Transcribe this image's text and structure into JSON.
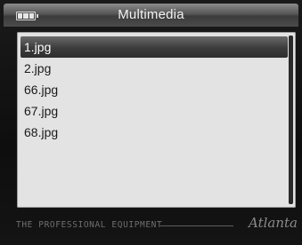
{
  "window": {
    "title": "Multimedia"
  },
  "status": {
    "battery_icon": "battery-icon"
  },
  "files": [
    {
      "name": "1.jpg",
      "selected": true
    },
    {
      "name": "2.jpg",
      "selected": false
    },
    {
      "name": "66.jpg",
      "selected": false
    },
    {
      "name": "67.jpg",
      "selected": false
    },
    {
      "name": "68.jpg",
      "selected": false
    }
  ],
  "footer": {
    "tagline": "THE PROFESSIONAL EQUIPMENT",
    "brand": "Atlanta"
  },
  "colors": {
    "selection": "#3c3c3c",
    "list_background": "#e3e3e3",
    "device_background": "#0e0e0e"
  }
}
